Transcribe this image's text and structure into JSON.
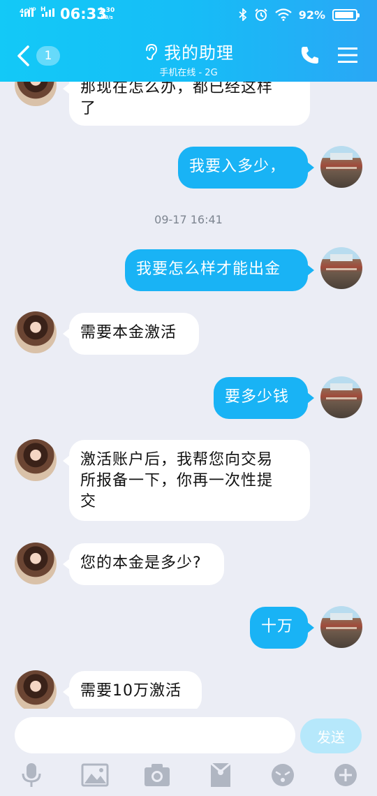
{
  "status_bar": {
    "network1": "4G",
    "network1_sup": "HD",
    "network2": "H",
    "time": "06:33",
    "speed_value": "1.30",
    "speed_unit": "KB/s",
    "battery": "92%",
    "battery_level": 0.92
  },
  "header": {
    "unread_count": "1",
    "title": "我的助理",
    "subtitle": "手机在线 - 2G"
  },
  "messages": [
    {
      "side": "theirs",
      "text_lines": [
        "那现在怎么办，都已经这样",
        "了"
      ]
    },
    {
      "side": "mine",
      "text_lines": [
        "我要入多少，"
      ]
    },
    {
      "type": "timestamp",
      "text": "09-17 16:41"
    },
    {
      "side": "mine",
      "text_lines": [
        "我要怎么样才能出金"
      ]
    },
    {
      "side": "theirs",
      "text_lines": [
        "需要本金激活"
      ]
    },
    {
      "side": "mine",
      "text_lines": [
        "要多少钱"
      ]
    },
    {
      "side": "theirs",
      "text_lines": [
        "激活账户后，我帮您向交易",
        "所报备一下，你再一次性提",
        "交"
      ]
    },
    {
      "side": "theirs",
      "text_lines": [
        "您的本金是多少?"
      ]
    },
    {
      "side": "mine",
      "text_lines": [
        "十万"
      ]
    },
    {
      "side": "theirs",
      "text_lines": [
        "需要10万激活"
      ]
    }
  ],
  "input": {
    "value": "",
    "placeholder": "",
    "send_label": "发送"
  },
  "toolbar": {
    "icons": [
      "microphone-icon",
      "image-icon",
      "camera-icon",
      "red-packet-icon",
      "emoji-icon",
      "plus-icon"
    ]
  },
  "colors": {
    "header_gradient_start": "#13c9f7",
    "header_gradient_end": "#2aa7f5",
    "my_bubble": "#19b3f5",
    "their_bubble": "#ffffff",
    "background": "#ebedf5",
    "send_button": "#b6e8fb"
  }
}
